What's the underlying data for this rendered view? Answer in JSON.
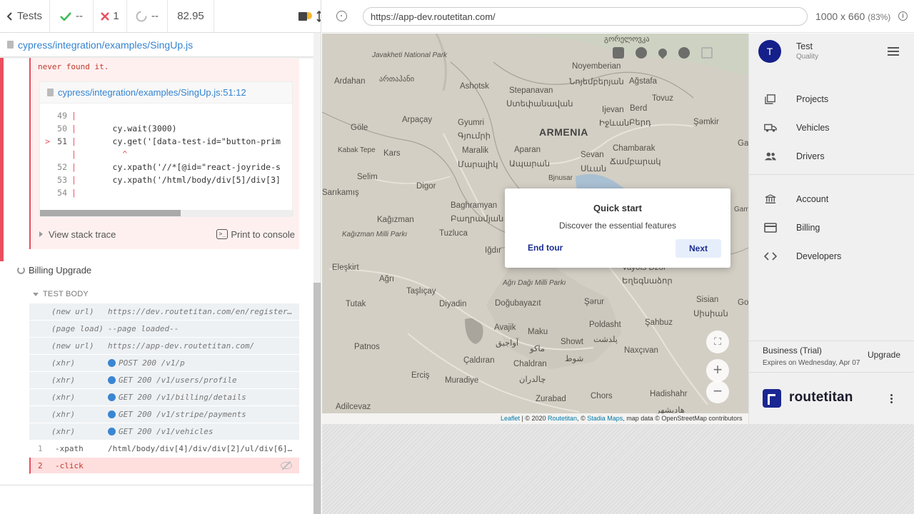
{
  "reporter": {
    "tests_label": "Tests",
    "passed": "--",
    "failed": "1",
    "pending": "--",
    "duration": "82.95",
    "spec_path": "cypress/integration/examples/SingUp.js",
    "error": {
      "message_tail": "never found it.",
      "frame_path": "cypress/integration/examples/SingUp.js:51:12",
      "lines": [
        {
          "num": "49",
          "code": "",
          "marker": ""
        },
        {
          "num": "50",
          "code": "      cy.wait(3000)",
          "marker": ""
        },
        {
          "num": "51",
          "code": "      cy.get('[data-test-id=\"button-prim",
          "marker": ">"
        },
        {
          "num": "",
          "code": "        ^",
          "marker": ""
        },
        {
          "num": "52",
          "code": "      cy.xpath('//*[@id=\"react-joyride-s",
          "marker": ""
        },
        {
          "num": "53",
          "code": "      cy.xpath('/html/body/div[5]/div[3]",
          "marker": ""
        },
        {
          "num": "54",
          "code": "",
          "marker": ""
        }
      ],
      "view_stack_trace": "View stack trace",
      "print_console": "Print to console",
      "console_glyph": ">_"
    },
    "test_title": "Billing Upgrade",
    "test_body_label": "TEST BODY",
    "commands": [
      {
        "name": "(new url)",
        "message": "https://dev.routetitan.com/en/register…",
        "dot": false
      },
      {
        "name": "(page load)",
        "message": "--page loaded--",
        "dot": false
      },
      {
        "name": "(new url)",
        "message": "https://app-dev.routetitan.com/",
        "dot": false
      },
      {
        "name": "(xhr)",
        "message": "POST 200 /v1/p",
        "dot": true
      },
      {
        "name": "(xhr)",
        "message": "GET 200 /v1/users/profile",
        "dot": true
      },
      {
        "name": "(xhr)",
        "message": "GET 200 /v1/billing/details",
        "dot": true
      },
      {
        "name": "(xhr)",
        "message": "GET 200 /v1/stripe/payments",
        "dot": true
      },
      {
        "name": "(xhr)",
        "message": "GET 200 /v1/vehicles",
        "dot": true
      }
    ],
    "steps": [
      {
        "num": "1",
        "name": "-xpath",
        "message": "/html/body/div[4]/div/div[2]/ul/div[6]…"
      },
      {
        "num": "2",
        "name": "-click",
        "message": ""
      }
    ]
  },
  "aut": {
    "url": "https://app-dev.routetitan.com/",
    "viewport": "1000 x 660",
    "scale": "(83%)",
    "info_glyph": "i"
  },
  "map": {
    "labels": {
      "javakheti": "Javakheti National Park",
      "gorelovka": "გორელოვკა",
      "noyemberian": "Noyemberian",
      "noyemberian_arm": "Նոյեմբերյան",
      "agstafa": "Ağstafa",
      "ardahan": "Ardahan",
      "ardahan_geo": "ართაჰანი",
      "ashotsk": "Ashotsk",
      "stepanavan": "Stepanavan",
      "stepanavan_arm": "Ստեփանավան",
      "tovuz": "Tovuz",
      "ijevan": "Ijevan",
      "ijevan_arm": "Իջևան",
      "berd": "Berd",
      "berd_arm": "Բերդ",
      "arpacay": "Arpaçay",
      "gyumri": "Gyumri",
      "gyumri_arm": "Գյումրի",
      "armenia": "ARMENIA",
      "samkir": "Şəmkir",
      "gole": "Göle",
      "kabak": "Kabak Tepe",
      "kars": "Kars",
      "maralik": "Maralik",
      "maralik_arm": "Մարալիկ",
      "aparan": "Aparan",
      "aparan_arm": "Ապարան",
      "sevan": "Sevan",
      "sevan_arm": "Սևան",
      "chambarak": "Chambarak",
      "chambarak_arm": "Ճամբարակ",
      "bjnusar": "Bjnusar",
      "selim": "Selim",
      "digor": "Digor",
      "sarikamis": "Sarıkamış",
      "baghramyan": "Baghramyan",
      "baghramyan_arm": "Բաղրամյան",
      "kagizman": "Kağızman",
      "kagizman_park": "Kağızman Milli Parkı",
      "tuzluca": "Tuzluca",
      "igdir": "Iğdır",
      "eleskirt": "Eleşkirt",
      "agri": "Ağrı",
      "agri_park": "Ağrı Dağı Milli Parkı",
      "vayots": "Vayots Dzor",
      "vayots_arm": "Եղեգնաձոր",
      "tasliçay": "Taşlıçay",
      "diyadin": "Diyadin",
      "dogubayazit": "Doğubayazıt",
      "sarur": "Şərur",
      "sisian": "Sisian",
      "sisian_arm": "Սիսիան",
      "tutak": "Tutak",
      "avajik": "Avajik",
      "avajik_fa": "آواجیق",
      "maku": "Maku",
      "maku_fa": "ماکو",
      "poldasht": "Poldasht",
      "poldasht_fa": "پلدشت",
      "sahbuz": "Şahbuz",
      "patnos": "Patnos",
      "showt": "Showt",
      "showt_fa": "شوط",
      "naxcivan": "Naxçıvan",
      "caldiran": "Çaldıran",
      "chaldran": "Chaldran",
      "chaldran_fa": "چالدران",
      "ercis": "Erciş",
      "muradiye": "Muradiye",
      "zurabad": "Zurabad",
      "chors": "Chors",
      "hadishahr": "Hadishahr",
      "hadishahr_fa": "هادیشهر",
      "adilcevaz": "Adilcevaz",
      "gori": "Gori",
      "gam": "Gam",
      "gan": "Gan"
    },
    "attribution_prefix": "Leaflet",
    "attribution_mid": " | © 2020 ",
    "attribution_rt": "Routetitan",
    "attribution_mid2": ", © ",
    "attribution_stadia": "Stadia Maps",
    "attribution_tail": ", map data © OpenStreetMap contributors",
    "zoom_in": "+",
    "zoom_out": "−"
  },
  "tour": {
    "title": "Quick start",
    "subtitle": "Discover the essential features",
    "end_label": "End tour",
    "next_label": "Next"
  },
  "sidebar": {
    "avatar_letter": "T",
    "user_name": "Test",
    "user_role": "Quality",
    "nav": [
      {
        "label": "Projects",
        "icon": "projects-icon"
      },
      {
        "label": "Vehicles",
        "icon": "truck-icon"
      },
      {
        "label": "Drivers",
        "icon": "people-icon"
      },
      {
        "label": "Account",
        "icon": "bank-icon"
      },
      {
        "label": "Billing",
        "icon": "credit-card-icon"
      },
      {
        "label": "Developers",
        "icon": "code-icon"
      }
    ],
    "plan_name": "Business (Trial)",
    "plan_expiry": "Expires on Wednesday, Apr 07",
    "upgrade_label": "Upgrade",
    "brand_name": "routetitan"
  },
  "colors": {
    "cypress_fail": "#e94f5e",
    "cypress_link": "#3383d1",
    "brand_navy": "#1a2691",
    "xhr_dot": "#3a86d3"
  }
}
